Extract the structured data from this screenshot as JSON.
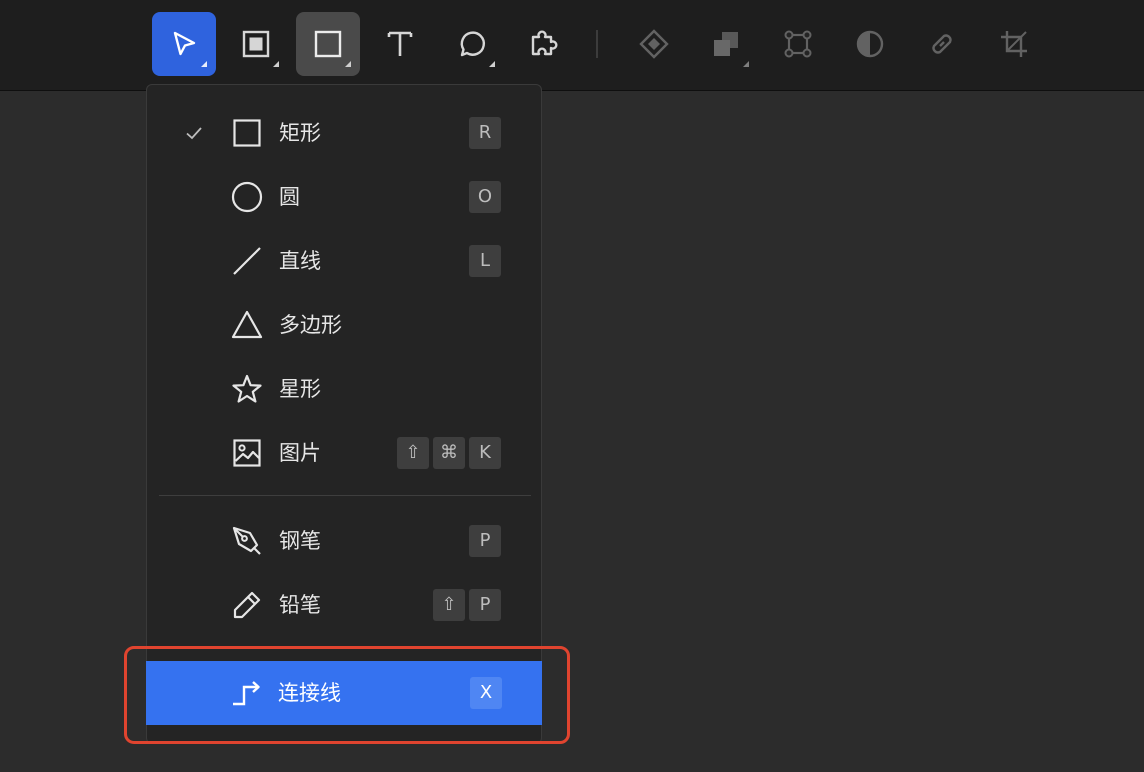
{
  "toolbar": {
    "tools": [
      {
        "name": "move-tool",
        "icon": "cursor-arrow-icon",
        "state": "selected"
      },
      {
        "name": "frame-tool",
        "icon": "frame-icon",
        "state": "normal"
      },
      {
        "name": "shape-tool",
        "icon": "rectangle-icon",
        "state": "active"
      },
      {
        "name": "text-tool",
        "icon": "text-icon",
        "state": "normal"
      },
      {
        "name": "comment-tool",
        "icon": "comment-bubble-icon",
        "state": "normal"
      },
      {
        "name": "plugin-tool",
        "icon": "puzzle-icon",
        "state": "normal"
      },
      {
        "name": "component-tool",
        "icon": "diamond-icon",
        "state": "disabled"
      },
      {
        "name": "boolean-tool",
        "icon": "boolean-union-icon",
        "state": "disabled"
      },
      {
        "name": "edit-path-tool",
        "icon": "vector-edit-icon",
        "state": "disabled"
      },
      {
        "name": "mask-tool",
        "icon": "mask-icon",
        "state": "disabled"
      },
      {
        "name": "link-tool",
        "icon": "link-icon",
        "state": "disabled"
      },
      {
        "name": "crop-tool",
        "icon": "crop-icon",
        "state": "disabled"
      }
    ]
  },
  "menu": {
    "items": [
      {
        "label": "矩形",
        "icon": "rectangle-icon",
        "keys": [
          "R"
        ],
        "checked": true
      },
      {
        "label": "圆",
        "icon": "circle-icon",
        "keys": [
          "O"
        ],
        "checked": false
      },
      {
        "label": "直线",
        "icon": "line-icon",
        "keys": [
          "L"
        ],
        "checked": false
      },
      {
        "label": "多边形",
        "icon": "triangle-icon",
        "keys": [],
        "checked": false
      },
      {
        "label": "星形",
        "icon": "star-icon",
        "keys": [],
        "checked": false
      },
      {
        "label": "图片",
        "icon": "image-icon",
        "keys": [
          "⇧",
          "⌘",
          "K"
        ],
        "checked": false
      },
      {
        "label": "钢笔",
        "icon": "pen-icon",
        "keys": [
          "P"
        ],
        "checked": false
      },
      {
        "label": "铅笔",
        "icon": "pencil-icon",
        "keys": [
          "⇧",
          "P"
        ],
        "checked": false
      },
      {
        "label": "连接线",
        "icon": "connector-icon",
        "keys": [
          "X"
        ],
        "checked": false,
        "highlighted": true
      }
    ]
  },
  "colors": {
    "accent": "#3572f0",
    "toolbar_selected": "#2f63de",
    "annotation": "#e0442f"
  }
}
